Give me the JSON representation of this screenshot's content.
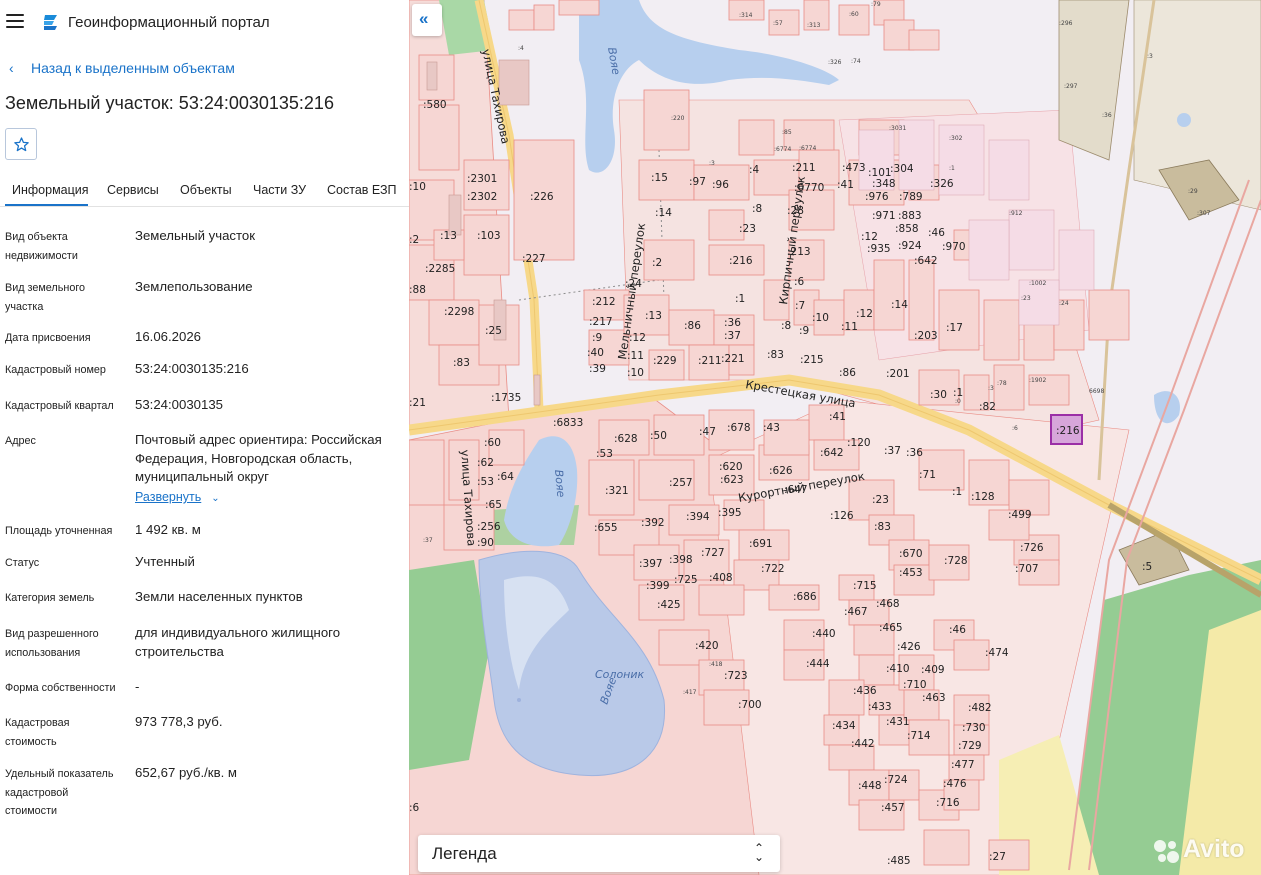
{
  "app": {
    "title": "Геоинформационный портал"
  },
  "nav": {
    "back_label": "Назад к выделенным объектам"
  },
  "object": {
    "title": "Земельный участок: 53:24:0030135:216"
  },
  "tabs": [
    {
      "label": "Информация",
      "active": true
    },
    {
      "label": "Сервисы"
    },
    {
      "label": "Объекты"
    },
    {
      "label": "Части ЗУ"
    },
    {
      "label": "Состав ЕЗП"
    }
  ],
  "fields": [
    {
      "label": "Вид объекта недвижимости",
      "value": "Земельный участок"
    },
    {
      "label": "Вид земельного участка",
      "value": "Землепользование"
    },
    {
      "label": "Дата присвоения",
      "value": "16.06.2026"
    },
    {
      "label": "Кадастровый номер",
      "value": "53:24:0030135:216"
    },
    {
      "label": "Кадастровый квартал",
      "value": "53:24:0030135"
    },
    {
      "label": "Адрес",
      "value": "Почтовый адрес ориентира: Российская Федерация, Новгородская область, муниципальный округ"
    },
    {
      "label": "Площадь уточненная",
      "value": "1 492 кв. м"
    },
    {
      "label": "Статус",
      "value": "Учтенный"
    },
    {
      "label": "Категория земель",
      "value": "Земли населенных пунктов"
    },
    {
      "label": "Вид разрешенного использования",
      "value": "для индивидуального жилищного строительства"
    },
    {
      "label": "Форма собственности",
      "value": "-"
    },
    {
      "label": "Кадастровая стоимость",
      "value": "973 778,3 руб."
    },
    {
      "label": "Удельный показатель кадастровой стоимости",
      "value": "652,67 руб./кв. м"
    }
  ],
  "address_expand_label": "Развернуть",
  "map": {
    "legend_label": "Легенда",
    "selected_parcel": ":216",
    "streets": [
      "Крестецкая улица",
      "улица Тахирова",
      "Мельничный переулок",
      "Кирпичный переулок",
      "Курортный переулок"
    ],
    "water_labels": [
      "Солоник",
      "Вояе"
    ],
    "watermark": "Avito",
    "colors": {
      "parcel_fill": "#f6d6d3",
      "parcel_stroke": "#e98c85",
      "selected": "#9b2fa6",
      "water": "#b7cfee",
      "road": "#f7d889",
      "green": "#95cc93"
    }
  },
  "icons": {
    "menu": "hamburger-icon",
    "logo": "portal-logo-icon",
    "star": "star-icon",
    "collapse": "double-chevron-left-icon"
  }
}
